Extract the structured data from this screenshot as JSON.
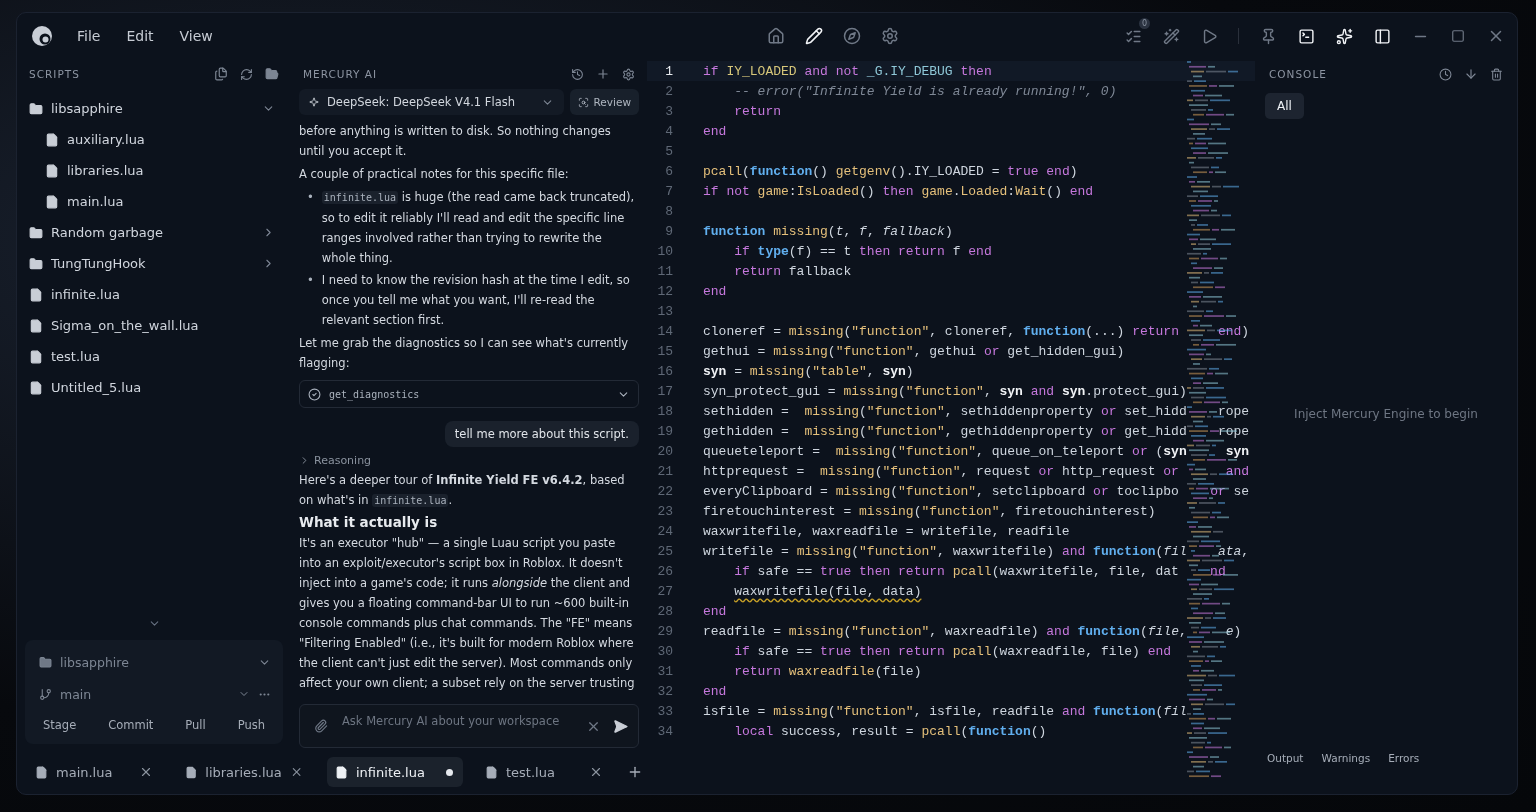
{
  "menu": [
    "File",
    "Edit",
    "View"
  ],
  "center_tools": [
    {
      "selected": false
    },
    {
      "selected": true
    },
    {
      "selected": false
    },
    {
      "selected": false
    }
  ],
  "right_tools": [
    {
      "active": false,
      "badge": "0"
    },
    {
      "active": false
    },
    {
      "active": false
    },
    {
      "active": false
    },
    {
      "active": true
    },
    {
      "active": true
    },
    {
      "active": true
    }
  ],
  "sidebar": {
    "title": "SCRIPTS",
    "tree": [
      {
        "kind": "folder",
        "name": "libsapphire",
        "expanded": true,
        "children": [
          {
            "kind": "file",
            "name": "auxiliary.lua"
          },
          {
            "kind": "file",
            "name": "libraries.lua"
          },
          {
            "kind": "file",
            "name": "main.lua"
          }
        ]
      },
      {
        "kind": "folder",
        "name": "Random garbage",
        "expanded": false
      },
      {
        "kind": "folder",
        "name": "TungTungHook",
        "expanded": false
      },
      {
        "kind": "file",
        "name": "infinite.lua"
      },
      {
        "kind": "file",
        "name": "Sigma_on_the_wall.lua"
      },
      {
        "kind": "file",
        "name": "test.lua"
      },
      {
        "kind": "file",
        "name": "Untitled_5.lua"
      }
    ]
  },
  "git": {
    "repo": "libsapphire",
    "branch": "main",
    "actions": [
      "Stage",
      "Commit",
      "Pull",
      "Push"
    ]
  },
  "ai": {
    "title": "MERCURY AI",
    "model": "DeepSeek: DeepSeek V4.1 Flash",
    "review": "Review",
    "messages": [
      {
        "kind": "para",
        "parts": [
          {
            "kind": "text",
            "text": "before anything is written to disk. So nothing changes until you accept it."
          }
        ]
      },
      {
        "kind": "para",
        "parts": [
          {
            "kind": "text",
            "text": "A couple of practical notes for this specific file:"
          }
        ]
      },
      {
        "kind": "list",
        "items": [
          {
            "marker": "•",
            "parts": [
              {
                "kind": "code",
                "text": "infinite.lua"
              },
              {
                "kind": "text",
                "text": " is huge (the read came back truncated), so to edit it reliably I'll read and edit the specific line ranges involved rather than trying to rewrite the whole thing."
              }
            ]
          },
          {
            "marker": "•",
            "parts": [
              {
                "kind": "text",
                "text": "I need to know the revision hash at the time I edit, so once you tell me what you want, I'll re-read the relevant section first."
              }
            ]
          }
        ]
      },
      {
        "kind": "para",
        "parts": [
          {
            "kind": "text",
            "text": "Let me grab the diagnostics so I can see what's currently flagging:"
          }
        ]
      },
      {
        "kind": "tool",
        "name": "get_diagnostics",
        "expanded": false
      },
      {
        "kind": "user",
        "text": "tell me more about this script."
      },
      {
        "kind": "reasoning",
        "label": "Reasoning",
        "expanded": false
      },
      {
        "kind": "para",
        "parts": [
          {
            "kind": "text",
            "text": "Here's a deeper tour of **Infinite Yield FE v6.4.2**, based on what's in "
          },
          {
            "kind": "code",
            "text": "infinite.lua"
          },
          {
            "kind": "text",
            "text": "."
          }
        ]
      },
      {
        "kind": "heading",
        "text": "What it actually is"
      },
      {
        "kind": "para",
        "parts": [
          {
            "kind": "text",
            "text": "It's an executor \"hub\" — a single Luau script you paste into an exploit/executor's script box in Roblox. It doesn't inject into a game's code; it runs *alongside* the client and gives you a floating command-bar UI to run ~600 built-in console commands plus chat commands. The \"FE\" means \"Filtering Enabled\" (i.e., it's built for modern Roblox where the client can't just edit the server). Most commands only affect your own client; a subset rely on the server trusting"
          }
        ]
      }
    ],
    "input_placeholder": "Ask Mercury AI about your workspace"
  },
  "tabs": [
    {
      "name": "main.lua",
      "selected": false,
      "modified": false
    },
    {
      "name": "libraries.lua",
      "selected": false,
      "modified": false
    },
    {
      "name": "infinite.lua",
      "selected": true,
      "modified": true
    },
    {
      "name": "test.lua",
      "selected": false,
      "modified": false
    }
  ],
  "editor": {
    "lines": [
      {
        "n": "1",
        "current": true,
        "indented": false,
        "seg": [
          {
            "kind": "keyword",
            "text": "if"
          },
          {
            "kind": "global",
            "text": " IY_LOADED "
          },
          {
            "kind": "keyword",
            "text": "and not "
          },
          {
            "kind": "field",
            "text": "_G.IY_DEBUG "
          },
          {
            "kind": "keyword",
            "text": "then"
          }
        ]
      },
      {
        "n": "2",
        "current": false,
        "indented": true,
        "seg": [
          {
            "kind": "comment",
            "text": "-- error(\"Infinite Yield is already running!\", 0)"
          }
        ]
      },
      {
        "n": "3",
        "current": false,
        "indented": true,
        "seg": [
          {
            "kind": "keyword",
            "text": "return"
          }
        ]
      },
      {
        "n": "4",
        "current": false,
        "indented": false,
        "seg": [
          {
            "kind": "keyword",
            "text": "end"
          }
        ]
      },
      {
        "n": "5",
        "current": false
      },
      {
        "n": "6",
        "current": false,
        "indented": false,
        "seg": [
          {
            "kind": "func",
            "text": "pcall"
          },
          {
            "kind": "plain",
            "text": "("
          },
          {
            "kind": "builtin",
            "text": "function"
          },
          {
            "kind": "plain",
            "text": "() "
          },
          {
            "kind": "func",
            "text": "getgenv"
          },
          {
            "kind": "plain",
            "text": "().IY_LOADED = "
          },
          {
            "kind": "keyword",
            "text": "true end"
          },
          {
            "kind": "plain",
            "text": ")"
          }
        ]
      },
      {
        "n": "7",
        "current": false,
        "indented": false,
        "seg": [
          {
            "kind": "keyword",
            "text": "if not "
          },
          {
            "kind": "func",
            "text": "game"
          },
          {
            "kind": "plain",
            "text": ":"
          },
          {
            "kind": "func",
            "text": "IsLoaded"
          },
          {
            "kind": "plain",
            "text": "() "
          },
          {
            "kind": "keyword",
            "text": "then "
          },
          {
            "kind": "func",
            "text": "game"
          },
          {
            "kind": "plain",
            "text": "."
          },
          {
            "kind": "func",
            "text": "Loaded"
          },
          {
            "kind": "plain",
            "text": ":"
          },
          {
            "kind": "func",
            "text": "Wait"
          },
          {
            "kind": "plain",
            "text": "() "
          },
          {
            "kind": "keyword",
            "text": "end"
          }
        ]
      },
      {
        "n": "8",
        "current": false
      },
      {
        "n": "9",
        "current": false,
        "indented": false,
        "seg": [
          {
            "kind": "builtin",
            "text": "function "
          },
          {
            "kind": "func",
            "text": "missing"
          },
          {
            "kind": "plain",
            "text": "("
          },
          {
            "kind": "param",
            "text": "t"
          },
          {
            "kind": "plain",
            "text": ", "
          },
          {
            "kind": "param",
            "text": "f"
          },
          {
            "kind": "plain",
            "text": ", "
          },
          {
            "kind": "param",
            "text": "fallback"
          },
          {
            "kind": "plain",
            "text": ")"
          }
        ]
      },
      {
        "n": "10",
        "current": false,
        "indented": true,
        "seg": [
          {
            "kind": "keyword",
            "text": "if "
          },
          {
            "kind": "builtin",
            "text": "type"
          },
          {
            "kind": "plain",
            "text": "(f) == t "
          },
          {
            "kind": "keyword",
            "text": "then return "
          },
          {
            "kind": "plain",
            "text": "f "
          },
          {
            "kind": "keyword",
            "text": "end"
          }
        ]
      },
      {
        "n": "11",
        "current": false,
        "indented": true,
        "seg": [
          {
            "kind": "keyword",
            "text": "return "
          },
          {
            "kind": "plain",
            "text": "fallback"
          }
        ]
      },
      {
        "n": "12",
        "current": false,
        "indented": false,
        "seg": [
          {
            "kind": "keyword",
            "text": "end"
          }
        ]
      },
      {
        "n": "13",
        "current": false
      },
      {
        "n": "14",
        "current": false,
        "indented": false,
        "seg": [
          {
            "kind": "plain",
            "text": "cloneref = "
          },
          {
            "kind": "func",
            "text": "missing"
          },
          {
            "kind": "plain",
            "text": "("
          },
          {
            "kind": "string",
            "text": "\"function\""
          },
          {
            "kind": "plain",
            "text": ", cloneref, "
          },
          {
            "kind": "builtin",
            "text": "function"
          },
          {
            "kind": "plain",
            "text": "(...) "
          },
          {
            "kind": "keyword",
            "text": "return     end"
          },
          {
            "kind": "plain",
            "text": ")"
          }
        ]
      },
      {
        "n": "15",
        "current": false,
        "indented": false,
        "seg": [
          {
            "kind": "plain",
            "text": "gethui = "
          },
          {
            "kind": "func",
            "text": "missing"
          },
          {
            "kind": "plain",
            "text": "("
          },
          {
            "kind": "string",
            "text": "\"function\""
          },
          {
            "kind": "plain",
            "text": ", gethui "
          },
          {
            "kind": "keyword",
            "text": "or "
          },
          {
            "kind": "plain",
            "text": "get_hidden_gui)"
          }
        ]
      },
      {
        "n": "16",
        "current": false,
        "indented": false,
        "seg": [
          {
            "kind": "bold",
            "text": "syn"
          },
          {
            "kind": "plain",
            "text": " = "
          },
          {
            "kind": "func",
            "text": "missing"
          },
          {
            "kind": "plain",
            "text": "("
          },
          {
            "kind": "string",
            "text": "\"table\""
          },
          {
            "kind": "plain",
            "text": ", "
          },
          {
            "kind": "bold",
            "text": "syn"
          },
          {
            "kind": "plain",
            "text": ")"
          }
        ]
      },
      {
        "n": "17",
        "current": false,
        "indented": false,
        "seg": [
          {
            "kind": "plain",
            "text": "syn_protect_gui = "
          },
          {
            "kind": "func",
            "text": "missing"
          },
          {
            "kind": "plain",
            "text": "("
          },
          {
            "kind": "string",
            "text": "\"function\""
          },
          {
            "kind": "plain",
            "text": ", "
          },
          {
            "kind": "bold",
            "text": "syn "
          },
          {
            "kind": "keyword",
            "text": "and "
          },
          {
            "kind": "bold",
            "text": "syn"
          },
          {
            "kind": "plain",
            "text": ".protect_gui)"
          }
        ]
      },
      {
        "n": "18",
        "current": false,
        "indented": false,
        "seg": [
          {
            "kind": "plain",
            "text": "sethidden =  "
          },
          {
            "kind": "func",
            "text": "missing"
          },
          {
            "kind": "plain",
            "text": "("
          },
          {
            "kind": "string",
            "text": "\"function\""
          },
          {
            "kind": "plain",
            "text": ", sethiddenproperty "
          },
          {
            "kind": "keyword",
            "text": "or "
          },
          {
            "kind": "plain",
            "text": "set_hidd    rope"
          }
        ]
      },
      {
        "n": "19",
        "current": false,
        "indented": false,
        "seg": [
          {
            "kind": "plain",
            "text": "gethidden =  "
          },
          {
            "kind": "func",
            "text": "missing"
          },
          {
            "kind": "plain",
            "text": "("
          },
          {
            "kind": "string",
            "text": "\"function\""
          },
          {
            "kind": "plain",
            "text": ", gethiddenproperty "
          },
          {
            "kind": "keyword",
            "text": "or "
          },
          {
            "kind": "plain",
            "text": "get_hidd    rope"
          }
        ]
      },
      {
        "n": "20",
        "current": false,
        "indented": false,
        "seg": [
          {
            "kind": "plain",
            "text": "queueteleport =  "
          },
          {
            "kind": "func",
            "text": "missing"
          },
          {
            "kind": "plain",
            "text": "("
          },
          {
            "kind": "string",
            "text": "\"function\""
          },
          {
            "kind": "plain",
            "text": ", queue_on_teleport "
          },
          {
            "kind": "keyword",
            "text": "or "
          },
          {
            "kind": "plain",
            "text": "("
          },
          {
            "kind": "bold",
            "text": "syn     syn"
          }
        ]
      },
      {
        "n": "21",
        "current": false,
        "indented": false,
        "seg": [
          {
            "kind": "plain",
            "text": "httprequest =  "
          },
          {
            "kind": "func",
            "text": "missing"
          },
          {
            "kind": "plain",
            "text": "("
          },
          {
            "kind": "string",
            "text": "\"function\""
          },
          {
            "kind": "plain",
            "text": ", request "
          },
          {
            "kind": "keyword",
            "text": "or "
          },
          {
            "kind": "plain",
            "text": "http_request "
          },
          {
            "kind": "keyword",
            "text": "or      and"
          }
        ]
      },
      {
        "n": "22",
        "current": false,
        "indented": false,
        "seg": [
          {
            "kind": "plain",
            "text": "everyClipboard = "
          },
          {
            "kind": "func",
            "text": "missing"
          },
          {
            "kind": "plain",
            "text": "("
          },
          {
            "kind": "string",
            "text": "\"function\""
          },
          {
            "kind": "plain",
            "text": ", setclipboard "
          },
          {
            "kind": "keyword",
            "text": "or "
          },
          {
            "kind": "plain",
            "text": "toclipbo    "
          },
          {
            "kind": "keyword",
            "text": "or "
          },
          {
            "kind": "plain",
            "text": "se"
          }
        ]
      },
      {
        "n": "23",
        "current": false,
        "indented": false,
        "seg": [
          {
            "kind": "plain",
            "text": "firetouchinterest = "
          },
          {
            "kind": "func",
            "text": "missing"
          },
          {
            "kind": "plain",
            "text": "("
          },
          {
            "kind": "string",
            "text": "\"function\""
          },
          {
            "kind": "plain",
            "text": ", firetouchinterest)"
          }
        ]
      },
      {
        "n": "24",
        "current": false,
        "indented": false,
        "seg": [
          {
            "kind": "plain",
            "text": "waxwritefile, waxreadfile = writefile, readfile"
          }
        ]
      },
      {
        "n": "25",
        "current": false,
        "indented": false,
        "seg": [
          {
            "kind": "plain",
            "text": "writefile = "
          },
          {
            "kind": "func",
            "text": "missing"
          },
          {
            "kind": "plain",
            "text": "("
          },
          {
            "kind": "string",
            "text": "\"function\""
          },
          {
            "kind": "plain",
            "text": ", waxwritefile) "
          },
          {
            "kind": "keyword",
            "text": "and "
          },
          {
            "kind": "builtin",
            "text": "function"
          },
          {
            "kind": "plain",
            "text": "("
          },
          {
            "kind": "param",
            "text": "fil    ata"
          },
          {
            "kind": "plain",
            "text": ","
          }
        ]
      },
      {
        "n": "26",
        "current": false,
        "indented": true,
        "seg": [
          {
            "kind": "keyword",
            "text": "if "
          },
          {
            "kind": "plain",
            "text": "safe == "
          },
          {
            "kind": "keyword",
            "text": "true then return "
          },
          {
            "kind": "func",
            "text": "pcall"
          },
          {
            "kind": "plain",
            "text": "(waxwritefile, file, dat    "
          },
          {
            "kind": "keyword",
            "text": "nd"
          }
        ]
      },
      {
        "n": "27",
        "current": false,
        "indented": true,
        "seg": [
          {
            "kind": "warning",
            "text": "waxwritefile(file, data)"
          }
        ]
      },
      {
        "n": "28",
        "current": false,
        "indented": false,
        "seg": [
          {
            "kind": "keyword",
            "text": "end"
          }
        ]
      },
      {
        "n": "29",
        "current": false,
        "indented": false,
        "seg": [
          {
            "kind": "plain",
            "text": "readfile = "
          },
          {
            "kind": "func",
            "text": "missing"
          },
          {
            "kind": "plain",
            "text": "("
          },
          {
            "kind": "string",
            "text": "\"function\""
          },
          {
            "kind": "plain",
            "text": ", waxreadfile) "
          },
          {
            "kind": "keyword",
            "text": "and "
          },
          {
            "kind": "builtin",
            "text": "function"
          },
          {
            "kind": "plain",
            "text": "("
          },
          {
            "kind": "param",
            "text": "file"
          },
          {
            "kind": "plain",
            "text": ",     "
          },
          {
            "kind": "param",
            "text": "e"
          },
          {
            "kind": "plain",
            "text": ")"
          }
        ]
      },
      {
        "n": "30",
        "current": false,
        "indented": true,
        "seg": [
          {
            "kind": "keyword",
            "text": "if "
          },
          {
            "kind": "plain",
            "text": "safe == "
          },
          {
            "kind": "keyword",
            "text": "true then return "
          },
          {
            "kind": "func",
            "text": "pcall"
          },
          {
            "kind": "plain",
            "text": "(waxreadfile, file) "
          },
          {
            "kind": "keyword",
            "text": "end"
          }
        ]
      },
      {
        "n": "31",
        "current": false,
        "indented": true,
        "seg": [
          {
            "kind": "keyword",
            "text": "return "
          },
          {
            "kind": "func",
            "text": "waxreadfile"
          },
          {
            "kind": "plain",
            "text": "(file)"
          }
        ]
      },
      {
        "n": "32",
        "current": false,
        "indented": false,
        "seg": [
          {
            "kind": "keyword",
            "text": "end"
          }
        ]
      },
      {
        "n": "33",
        "current": false,
        "indented": false,
        "seg": [
          {
            "kind": "plain",
            "text": "isfile = "
          },
          {
            "kind": "func",
            "text": "missing"
          },
          {
            "kind": "plain",
            "text": "("
          },
          {
            "kind": "string",
            "text": "\"function\""
          },
          {
            "kind": "plain",
            "text": ", isfile, readfile "
          },
          {
            "kind": "keyword",
            "text": "and "
          },
          {
            "kind": "builtin",
            "text": "function"
          },
          {
            "kind": "plain",
            "text": "("
          },
          {
            "kind": "param",
            "text": "fil"
          }
        ]
      },
      {
        "n": "34",
        "current": false,
        "indented": true,
        "seg": [
          {
            "kind": "keyword",
            "text": "local "
          },
          {
            "kind": "plain",
            "text": "success, result = "
          },
          {
            "kind": "func",
            "text": "pcall"
          },
          {
            "kind": "plain",
            "text": "("
          },
          {
            "kind": "builtin",
            "text": "function"
          },
          {
            "kind": "plain",
            "text": "()"
          }
        ]
      }
    ]
  },
  "console": {
    "title": "CONSOLE",
    "filters": [
      {
        "label": "All",
        "selected": true
      }
    ],
    "empty": "Inject Mercury Engine to begin",
    "tabs": [
      "Output",
      "Warnings",
      "Errors"
    ]
  }
}
